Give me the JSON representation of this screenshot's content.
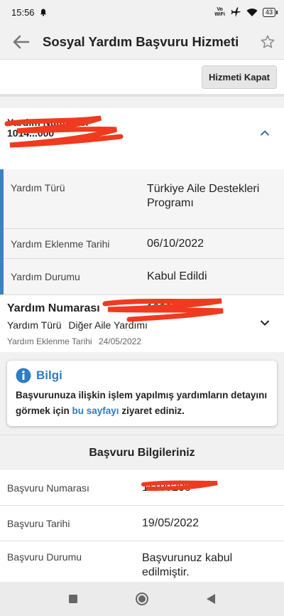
{
  "status": {
    "time": "15:56",
    "volte_top": "Vo",
    "volte_bottom": "WiFi",
    "battery": "43"
  },
  "appbar": {
    "title": "Sosyal Yardım Başvuru Hizmeti"
  },
  "actions": {
    "close_service": "Hizmeti Kapat"
  },
  "aid_expanded": {
    "number_label": "Yardım Numarası",
    "number_value": "1014...000",
    "rows": [
      {
        "label": "Yardım Türü",
        "value": "Türkiye Aile Destekleri Programı"
      },
      {
        "label": "Yardım Eklenme Tarihi",
        "value": "06/10/2022"
      },
      {
        "label": "Yardım Durumu",
        "value": "Kabul Edildi"
      }
    ]
  },
  "aid_collapsed": {
    "number_label": "Yardım Numarası",
    "number_value": "...1033",
    "type_label": "Yardım Türü",
    "type_value": "Diğer Aile Yardımı",
    "date_label": "Yardım Eklenme Tarihi",
    "date_value": "24/05/2022"
  },
  "info": {
    "title": "Bilgi",
    "text_before": "Başvurunuza ilişkin işlem yapılmış yardımların detayını görmek için ",
    "link": "bu sayfayı",
    "text_after": " ziyaret ediniz."
  },
  "application": {
    "section_title": "Başvuru Bilgileriniz",
    "rows": [
      {
        "label": "Başvuru Numarası",
        "value": "11199200"
      },
      {
        "label": "Başvuru Tarihi",
        "value": "19/05/2022"
      },
      {
        "label": "Başvuru Durumu",
        "value": "Başvurunuz kabul edilmiştir."
      }
    ]
  },
  "colors": {
    "accent": "#2f7dc1",
    "redaction": "#f03a1f"
  }
}
